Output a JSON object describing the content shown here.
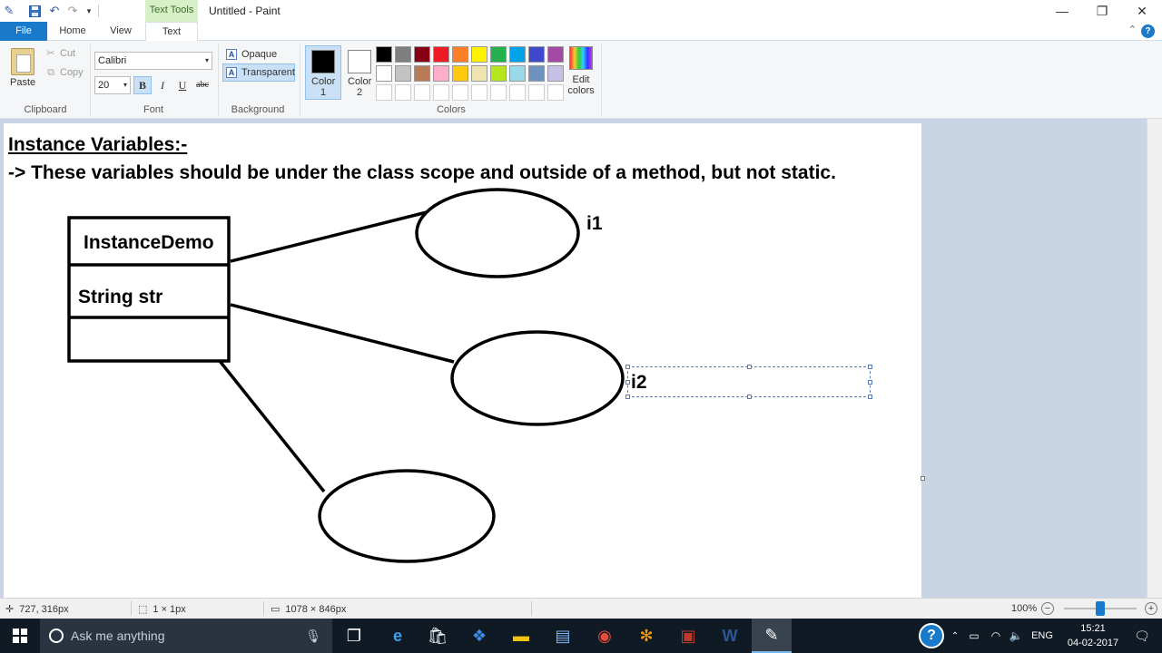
{
  "window": {
    "title": "Untitled - Paint",
    "context_tab": "Text Tools"
  },
  "tabs": {
    "file": "File",
    "home": "Home",
    "view": "View",
    "text": "Text"
  },
  "ribbon": {
    "clipboard": {
      "label": "Clipboard",
      "paste": "Paste",
      "cut": "Cut",
      "copy": "Copy"
    },
    "font": {
      "label": "Font",
      "name": "Calibri",
      "size": "20",
      "bold": "B",
      "italic": "I",
      "underline": "U",
      "strike": "abc"
    },
    "background": {
      "label": "Background",
      "opaque": "Opaque",
      "transparent": "Transparent",
      "selected": "transparent"
    },
    "colors": {
      "label": "Colors",
      "color1": "Color 1",
      "color2": "Color 2",
      "color1_value": "#000000",
      "color2_value": "#ffffff",
      "edit": "Edit colors",
      "palette": [
        "#000000",
        "#7f7f7f",
        "#880015",
        "#ed1c24",
        "#ff7f27",
        "#fff200",
        "#22b14c",
        "#00a2e8",
        "#3f48cc",
        "#a349a4",
        "#ffffff",
        "#c3c3c3",
        "#b97a57",
        "#ffaec9",
        "#ffc90e",
        "#efe4b0",
        "#b5e61d",
        "#99d9ea",
        "#7092be",
        "#c8bfe7"
      ]
    }
  },
  "canvas": {
    "title": "Instance Variables:-",
    "description": "-> These variables should be under the class scope and outside of a method, but not static.",
    "class_name": "InstanceDemo",
    "field": "String str",
    "label_i1": "i1",
    "label_i2": "i2"
  },
  "status": {
    "cursor": "727, 316px",
    "selection": "1 × 1px",
    "canvas_size": "1078 × 846px",
    "zoom": "100%",
    "zoom_fraction": 0.5
  },
  "taskbar": {
    "search_placeholder": "Ask me anything",
    "language": "ENG",
    "time": "15:21",
    "date": "04-02-2017"
  }
}
